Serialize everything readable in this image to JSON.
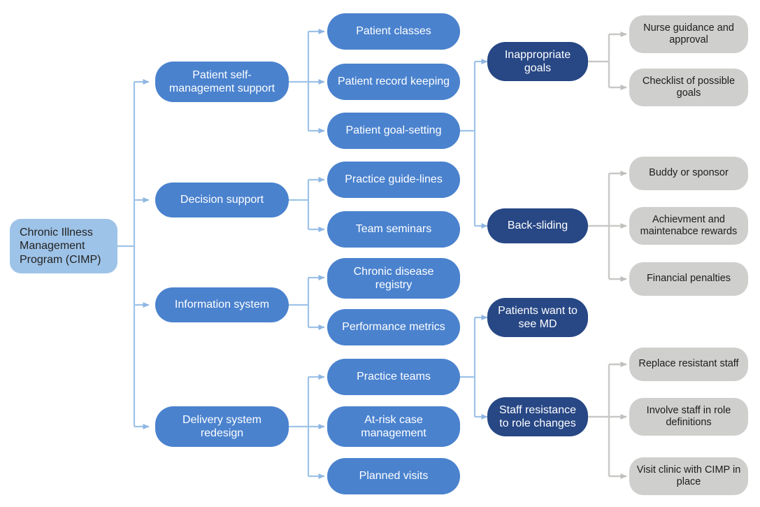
{
  "diagram": {
    "title": "Chronic Illness Management Program (CIMP)",
    "colors": {
      "root_fill": "#9EC3E8",
      "component_fill": "#4A82CE",
      "element_fill": "#4A82CE",
      "barrier_fill": "#274785",
      "solution_fill": "#CFCFCD",
      "blue_connector": "#9EC3E8",
      "gray_connector": "#C8C8C6",
      "background": "#FFFFFF"
    },
    "root": {
      "id": "root",
      "label": "Chronic Illness Management Program (CIMP)"
    },
    "components": [
      {
        "id": "c1",
        "label": "Patient self-management support"
      },
      {
        "id": "c2",
        "label": "Decision support"
      },
      {
        "id": "c3",
        "label": "Information system"
      },
      {
        "id": "c4",
        "label": "Delivery system redesign"
      }
    ],
    "elements": [
      {
        "id": "e1",
        "label": "Patient classes",
        "parent": "c1"
      },
      {
        "id": "e2",
        "label": "Patient record keeping",
        "parent": "c1"
      },
      {
        "id": "e3",
        "label": "Patient goal-setting",
        "parent": "c1"
      },
      {
        "id": "e4",
        "label": "Practice guide-lines",
        "parent": "c2"
      },
      {
        "id": "e5",
        "label": "Team seminars",
        "parent": "c2"
      },
      {
        "id": "e6",
        "label": "Chronic disease registry",
        "parent": "c3"
      },
      {
        "id": "e7",
        "label": "Performance metrics",
        "parent": "c3"
      },
      {
        "id": "e8",
        "label": "Practice teams",
        "parent": "c4"
      },
      {
        "id": "e9",
        "label": "At-risk case management",
        "parent": "c4"
      },
      {
        "id": "e10",
        "label": "Planned visits",
        "parent": "c4"
      }
    ],
    "barriers": [
      {
        "id": "b1",
        "label": "Inappropriate goals",
        "parent": "e3"
      },
      {
        "id": "b2",
        "label": "Back-sliding",
        "parent": "e3"
      },
      {
        "id": "b3",
        "label": "Patients want to see MD",
        "parent": "e8"
      },
      {
        "id": "b4",
        "label": "Staff resistance to role changes",
        "parent": "e8"
      }
    ],
    "solutions": [
      {
        "id": "s1",
        "label": "Nurse guidance and approval",
        "parent": "b1"
      },
      {
        "id": "s2",
        "label": "Checklist of possible goals",
        "parent": "b1"
      },
      {
        "id": "s3",
        "label": "Buddy or sponsor",
        "parent": "b2"
      },
      {
        "id": "s4",
        "label": "Achievment and maintenabce rewards",
        "parent": "b2"
      },
      {
        "id": "s5",
        "label": "Financial penalties",
        "parent": "b2"
      },
      {
        "id": "s6",
        "label": "Replace resistant staff",
        "parent": "b4"
      },
      {
        "id": "s7",
        "label": "Involve staff in role definitions",
        "parent": "b4"
      },
      {
        "id": "s8",
        "label": "Visit clinic with CIMP in place",
        "parent": "b4"
      }
    ]
  }
}
